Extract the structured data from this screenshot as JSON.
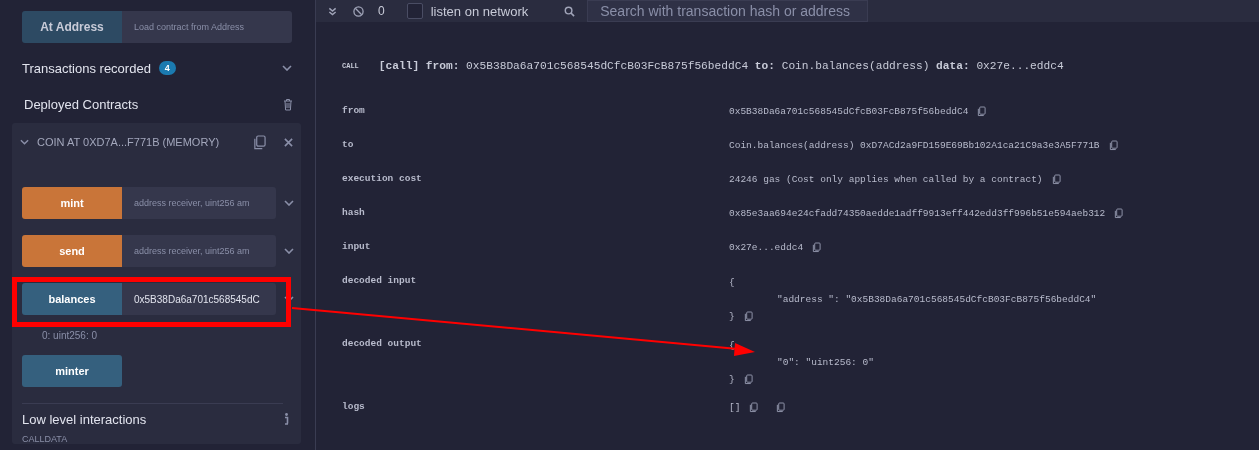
{
  "at_address": {
    "button": "At Address",
    "placeholder": "Load contract from Address"
  },
  "transactions": {
    "label": "Transactions recorded",
    "count": "4",
    "expanded": false
  },
  "deployed": {
    "title": "Deployed Contracts"
  },
  "contract": {
    "title": "COIN AT 0XD7A...F771B (MEMORY)",
    "expanded": true,
    "functions": [
      {
        "name": "mint",
        "kind": "transact",
        "placeholder": "address receiver, uint256 am"
      },
      {
        "name": "send",
        "kind": "transact",
        "placeholder": "address receiver, uint256 am"
      },
      {
        "name": "balances",
        "kind": "call",
        "value": "0x5B38Da6a701c568545dC",
        "result": "0: uint256: 0"
      },
      {
        "name": "minter",
        "kind": "call"
      }
    ]
  },
  "low_level": {
    "title": "Low level interactions",
    "calldata_label": "CALLDATA"
  },
  "toolbar": {
    "count": "0",
    "listen": {
      "label": "listen on network",
      "checked": false
    },
    "search": {
      "placeholder": "Search with transaction hash or address"
    }
  },
  "transaction": {
    "badge": "CALL",
    "summary": "**[call]** **from:** 0x5B38Da6a701c568545dCfcB03FcB875f56beddC4 **to:** Coin.balances(address) **data:** 0x27e...eddc4",
    "rows": [
      {
        "label": "from",
        "kind": "text",
        "value": "0x5B38Da6a701c568545dCfcB03FcB875f56beddC4"
      },
      {
        "label": "to",
        "kind": "text",
        "value": "Coin.balances(address) 0xD7ACd2a9FD159E69Bb102A1ca21C9a3e3A5F771B"
      },
      {
        "label": "execution cost",
        "kind": "text",
        "value": "24246 gas (Cost only applies when called by a contract)"
      },
      {
        "label": "hash",
        "kind": "text",
        "value": "0x85e3aa694e24cfadd74350aedde1adff9913eff442edd3ff996b51e594aeb312"
      },
      {
        "label": "input",
        "kind": "text",
        "value": "0x27e...eddc4"
      },
      {
        "label": "decoded input",
        "kind": "json",
        "lines": [
          "{",
          "\"address \": \"0x5B38Da6a701c568545dCfcB03FcB875f56beddC4\"",
          "}"
        ]
      },
      {
        "label": "decoded output",
        "kind": "json",
        "lines": [
          "{",
          "\"0\": \"uint256: 0\"",
          "}"
        ]
      },
      {
        "label": "logs",
        "kind": "logs",
        "value": "[]"
      }
    ]
  }
}
